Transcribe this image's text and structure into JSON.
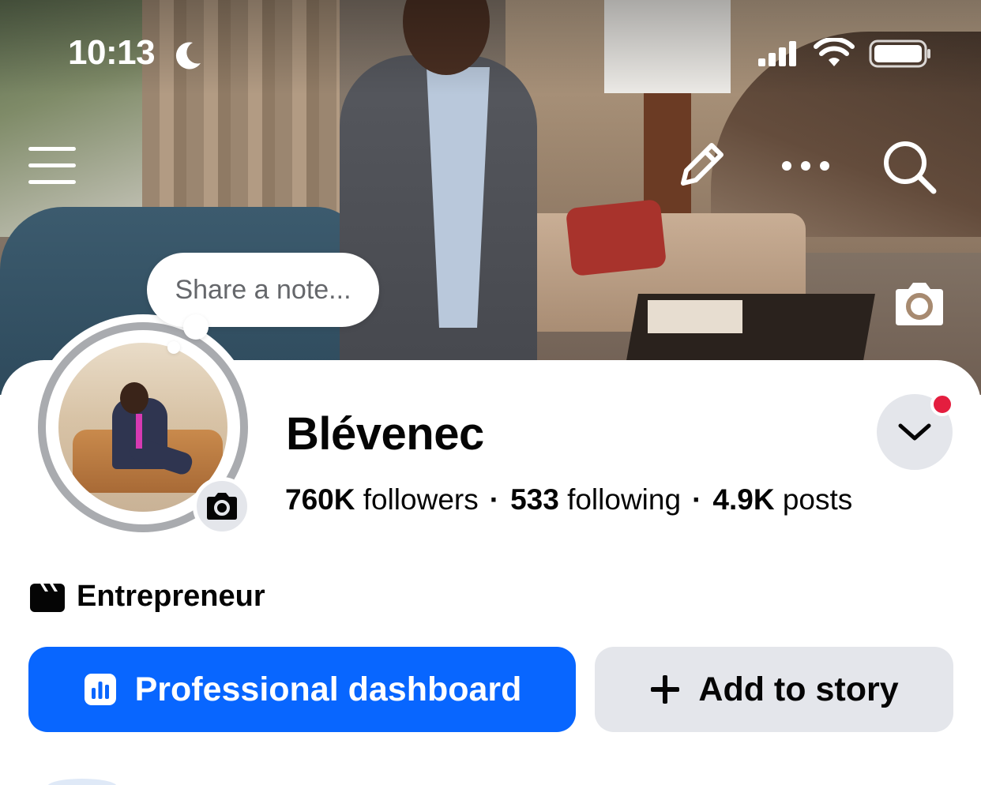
{
  "status_bar": {
    "time": "10:13"
  },
  "note": {
    "placeholder": "Share a note..."
  },
  "profile": {
    "name": "Blévenec",
    "stats": {
      "followers_value": "760K",
      "followers_label": "followers",
      "following_value": "533",
      "following_label": "following",
      "posts_value": "4.9K",
      "posts_label": "posts",
      "separator": "·"
    },
    "category": "Entrepreneur"
  },
  "actions": {
    "professional_dashboard": "Professional dashboard",
    "add_to_story": "Add to story"
  },
  "icons": {
    "menu": "hamburger-menu-icon",
    "edit": "pencil-icon",
    "more": "more-dots-icon",
    "search": "search-icon",
    "cover_camera": "camera-icon",
    "avatar_camera": "camera-icon",
    "dropdown": "chevron-down-icon",
    "category": "clapperboard-icon",
    "dashboard": "bar-chart-icon",
    "add": "plus-icon"
  },
  "colors": {
    "primary": "#0866ff",
    "secondary_bg": "#e4e6eb",
    "notification": "#e41e3f",
    "text": "#050505",
    "muted_text": "#65676b"
  }
}
